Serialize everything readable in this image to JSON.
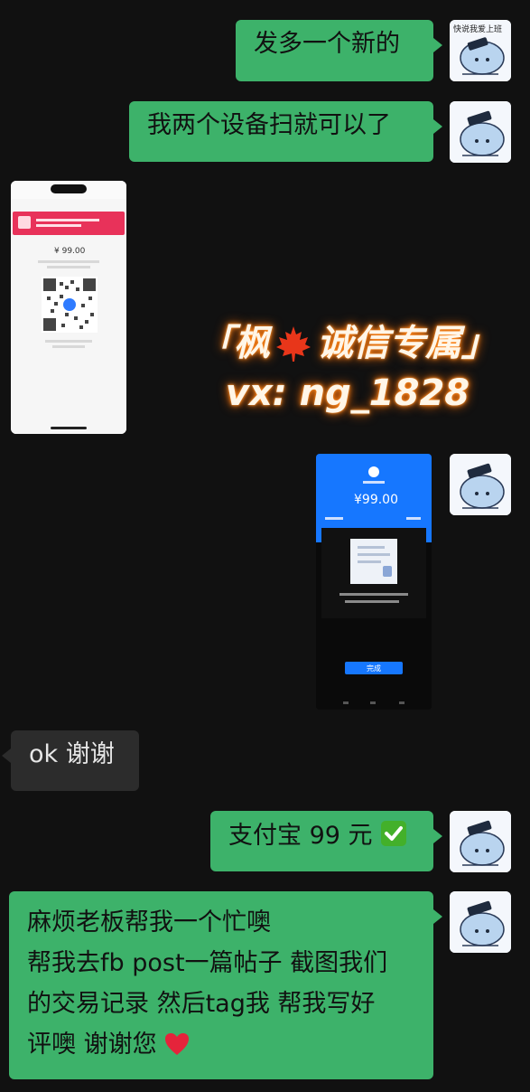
{
  "messages": {
    "m1": "发多一个新的",
    "m2": "我两个设备扫就可以了",
    "m3": "ok 谢谢",
    "m4": "支付宝 99 元",
    "m5_l1": "麻烦老板帮我一个忙噢",
    "m5_l2": "帮我去fb post一篇帖子 截图我们",
    "m5_l3": "的交易记录 然后tag我 帮我写好",
    "m5_l4": "评噢 谢谢您"
  },
  "watermark": {
    "line1_open": "「枫",
    "line1_close": "诚信专属」",
    "line2": "vx: ng_1828"
  },
  "screenshot_light": {
    "amount": "¥ 99.00"
  },
  "screenshot_dark": {
    "amount": "¥99.00",
    "button": "完成"
  },
  "avatar": {
    "caption": "快说我爱上班"
  },
  "colors": {
    "outgoing_bubble": "#3db26a",
    "incoming_bubble": "#2c2c2c",
    "background": "#111111",
    "alipay_blue": "#1677ff"
  }
}
